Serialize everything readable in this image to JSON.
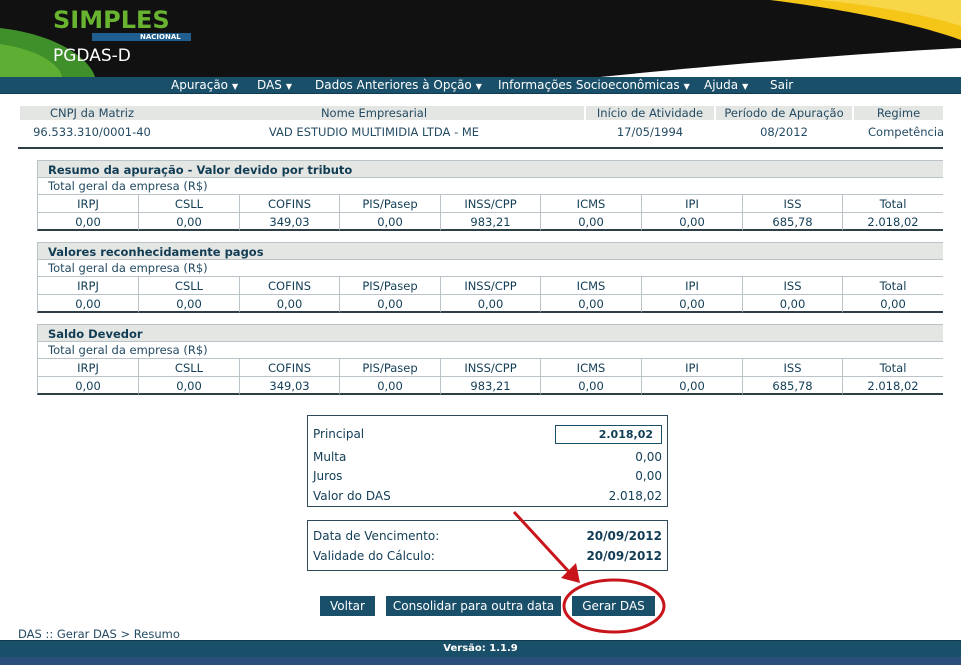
{
  "colors": {
    "nav_bg": "#1a4f6a",
    "header_bg": "#111111",
    "brand_green": "#68b32f",
    "brand_yellow": "#f5c518",
    "brand_blue": "#1f5e8f",
    "highlight_red": "#c8141b"
  },
  "brand": {
    "logo_word": "SIMPLES",
    "logo_sub": "NACIONAL",
    "app_name": "PGDAS-D"
  },
  "nav": {
    "items": [
      {
        "label": "Apuração",
        "dropdown": true
      },
      {
        "label": "DAS",
        "dropdown": true
      },
      {
        "label": "Dados Anteriores à Opção",
        "dropdown": true
      },
      {
        "label": "Informações Socioeconômicas",
        "dropdown": true
      },
      {
        "label": "Ajuda",
        "dropdown": true
      },
      {
        "label": "Sair",
        "dropdown": false
      }
    ],
    "caret": "▼"
  },
  "company": {
    "headers": [
      "CNPJ da Matriz",
      "Nome Empresarial",
      "Início de Atividade",
      "Período de Apuração",
      "Regime"
    ],
    "values": [
      "96.533.310/0001-40",
      "VAD ESTUDIO MULTIMIDIA LTDA - ME",
      "17/05/1994",
      "08/2012",
      "Competência"
    ]
  },
  "tributes": {
    "columns": [
      "IRPJ",
      "CSLL",
      "COFINS",
      "PIS/Pasep",
      "INSS/CPP",
      "ICMS",
      "IPI",
      "ISS",
      "Total"
    ],
    "sections": [
      {
        "title": "Resumo da apuração - Valor devido por tributo",
        "subtitle": "Total geral da empresa (R$)",
        "values": [
          "0,00",
          "0,00",
          "349,03",
          "0,00",
          "983,21",
          "0,00",
          "0,00",
          "685,78",
          "2.018,02"
        ]
      },
      {
        "title": "Valores reconhecidamente pagos",
        "subtitle": "Total geral da empresa (R$)",
        "values": [
          "0,00",
          "0,00",
          "0,00",
          "0,00",
          "0,00",
          "0,00",
          "0,00",
          "0,00",
          "0,00"
        ]
      },
      {
        "title": "Saldo Devedor",
        "subtitle": "Total geral da empresa (R$)",
        "values": [
          "0,00",
          "0,00",
          "349,03",
          "0,00",
          "983,21",
          "0,00",
          "0,00",
          "685,78",
          "2.018,02"
        ]
      }
    ]
  },
  "summary": {
    "principal_label": "Principal",
    "principal_value": "2.018,02",
    "multa_label": "Multa",
    "multa_value": "0,00",
    "juros_label": "Juros",
    "juros_value": "0,00",
    "valor_label": "Valor do DAS",
    "valor_value": "2.018,02"
  },
  "dates": {
    "vencimento_label": "Data de Vencimento:",
    "vencimento_value": "20/09/2012",
    "validade_label": "Validade do Cálculo:",
    "validade_value": "20/09/2012"
  },
  "actions": {
    "voltar": "Voltar",
    "consolidar": "Consolidar para outra data",
    "gerar": "Gerar DAS"
  },
  "breadcrumb": "DAS :: Gerar DAS > Resumo",
  "version": "Versão: 1.1.9"
}
